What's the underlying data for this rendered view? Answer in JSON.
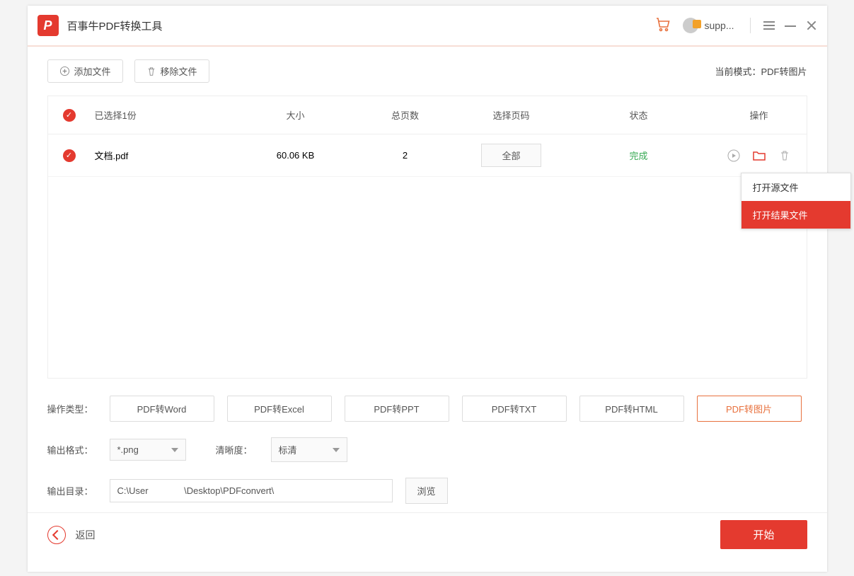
{
  "app": {
    "title": "百事牛PDF转换工具",
    "logo_letter": "P"
  },
  "header": {
    "user_name": "supp...",
    "cart": "cart-icon"
  },
  "toolbar": {
    "add_label": "添加文件",
    "remove_label": "移除文件",
    "mode_label_prefix": "当前模式：",
    "mode_value": "PDF转图片"
  },
  "table": {
    "headers": {
      "selected": "已选择1份",
      "size": "大小",
      "pages": "总页数",
      "page_range": "选择页码",
      "status": "状态",
      "action": "操作"
    },
    "row": {
      "filename": "文档.pdf",
      "size": "60.06 KB",
      "pages": "2",
      "range_btn": "全部",
      "status": "完成"
    }
  },
  "dropdown": {
    "open_source": "打开源文件",
    "open_result": "打开结果文件"
  },
  "options": {
    "type_label": "操作类型：",
    "types": [
      "PDF转Word",
      "PDF转Excel",
      "PDF转PPT",
      "PDF转TXT",
      "PDF转HTML",
      "PDF转图片"
    ],
    "format_label": "输出格式：",
    "format_value": "*.png",
    "quality_label": "清晰度：",
    "quality_value": "标清",
    "output_label": "输出目录：",
    "output_path": "C:\\User              \\Desktop\\PDFconvert\\",
    "browse_label": "浏览"
  },
  "footer": {
    "back_label": "返回",
    "start_label": "开始"
  }
}
